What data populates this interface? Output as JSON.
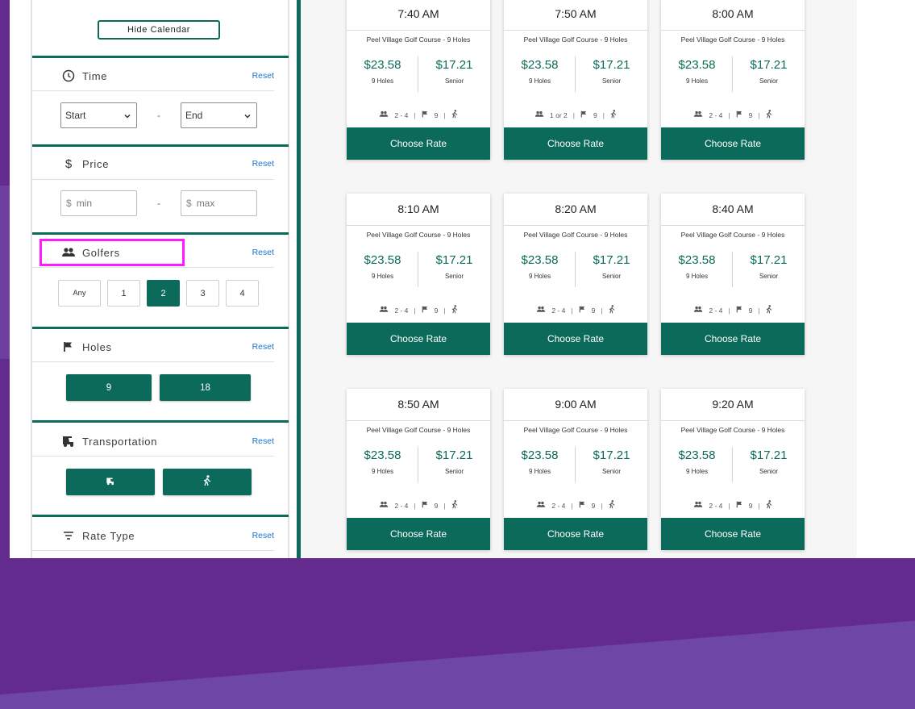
{
  "sidebar": {
    "calendar_toggle": "Hide Calendar",
    "time": {
      "title": "Time",
      "reset": "Reset",
      "start": "Start",
      "end": "End",
      "dash": "-"
    },
    "price": {
      "title": "Price",
      "reset": "Reset",
      "min_symbol": "$",
      "min_placeholder": "min",
      "max_symbol": "$",
      "max_placeholder": "max",
      "dash": "-"
    },
    "golfers": {
      "title": "Golfers",
      "reset": "Reset",
      "options": [
        "Any",
        "1",
        "2",
        "3",
        "4"
      ],
      "selected": "2"
    },
    "holes": {
      "title": "Holes",
      "reset": "Reset",
      "options": [
        "9",
        "18"
      ]
    },
    "transportation": {
      "title": "Transportation",
      "reset": "Reset",
      "options": [
        "cart-icon",
        "walking-icon"
      ]
    },
    "rate_type": {
      "title": "Rate Type",
      "reset": "Reset"
    }
  },
  "tee_times": [
    {
      "time": "7:40 AM",
      "course": "Peel Village Golf Course - 9 Holes",
      "price1": "$23.58",
      "label1": "9 Holes",
      "price2": "$17.21",
      "label2": "Senior",
      "players": "2 - 4",
      "holes": "9",
      "button": "Choose Rate"
    },
    {
      "time": "7:50 AM",
      "course": "Peel Village Golf Course - 9 Holes",
      "price1": "$23.58",
      "label1": "9 Holes",
      "price2": "$17.21",
      "label2": "Senior",
      "players": "1 or 2",
      "holes": "9",
      "button": "Choose Rate"
    },
    {
      "time": "8:00 AM",
      "course": "Peel Village Golf Course - 9 Holes",
      "price1": "$23.58",
      "label1": "9 Holes",
      "price2": "$17.21",
      "label2": "Senior",
      "players": "2 - 4",
      "holes": "9",
      "button": "Choose Rate"
    },
    {
      "time": "8:10 AM",
      "course": "Peel Village Golf Course - 9 Holes",
      "price1": "$23.58",
      "label1": "9 Holes",
      "price2": "$17.21",
      "label2": "Senior",
      "players": "2 - 4",
      "holes": "9",
      "button": "Choose Rate"
    },
    {
      "time": "8:20 AM",
      "course": "Peel Village Golf Course - 9 Holes",
      "price1": "$23.58",
      "label1": "9 Holes",
      "price2": "$17.21",
      "label2": "Senior",
      "players": "2 - 4",
      "holes": "9",
      "button": "Choose Rate"
    },
    {
      "time": "8:40 AM",
      "course": "Peel Village Golf Course - 9 Holes",
      "price1": "$23.58",
      "label1": "9 Holes",
      "price2": "$17.21",
      "label2": "Senior",
      "players": "2 - 4",
      "holes": "9",
      "button": "Choose Rate"
    },
    {
      "time": "8:50 AM",
      "course": "Peel Village Golf Course - 9 Holes",
      "price1": "$23.58",
      "label1": "9 Holes",
      "price2": "$17.21",
      "label2": "Senior",
      "players": "2 - 4",
      "holes": "9",
      "button": "Choose Rate"
    },
    {
      "time": "9:00 AM",
      "course": "Peel Village Golf Course - 9 Holes",
      "price1": "$23.58",
      "label1": "9 Holes",
      "price2": "$17.21",
      "label2": "Senior",
      "players": "2 - 4",
      "holes": "9",
      "button": "Choose Rate"
    },
    {
      "time": "9:20 AM",
      "course": "Peel Village Golf Course - 9 Holes",
      "price1": "$23.58",
      "label1": "9 Holes",
      "price2": "$17.21",
      "label2": "Senior",
      "players": "2 - 4",
      "holes": "9",
      "button": "Choose Rate"
    }
  ],
  "colors": {
    "accent": "#0b6a59",
    "link": "#1b73d0",
    "highlight": "#ff1aff",
    "background": "#642b8f"
  }
}
